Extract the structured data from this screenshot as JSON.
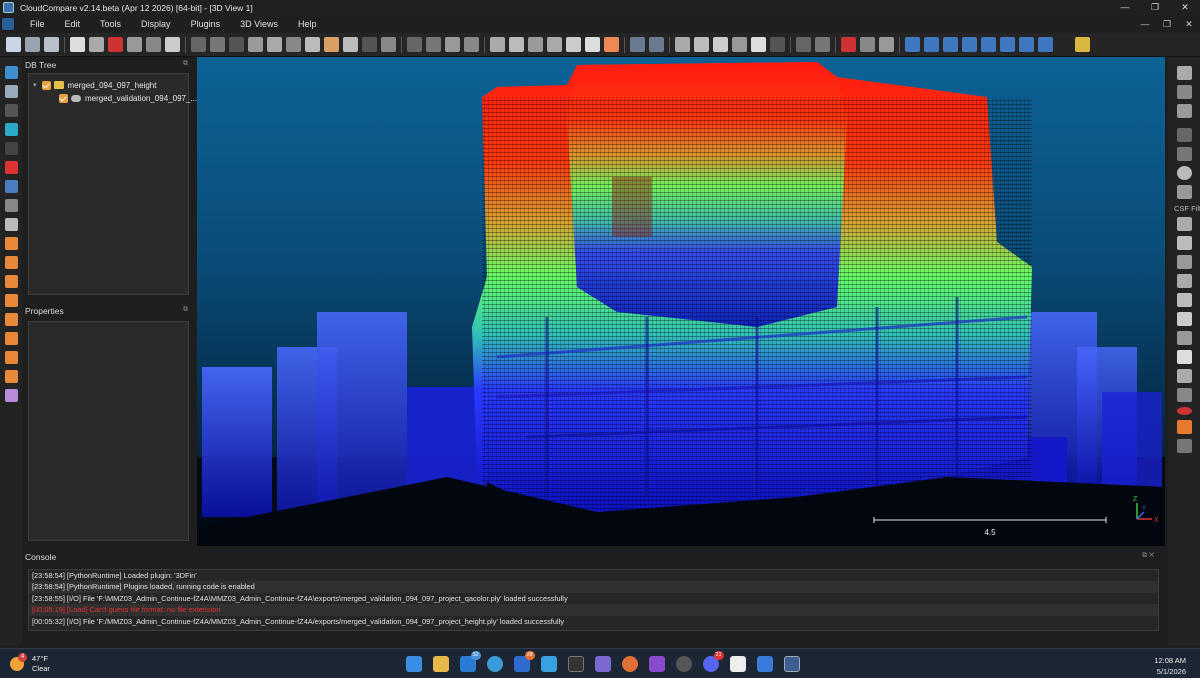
{
  "window": {
    "title": "CloudCompare v2.14.beta (Apr 12 2026) [64-bit] - [3D View 1]",
    "controls": [
      "—",
      "❐",
      "✕"
    ]
  },
  "menu": {
    "items": [
      "File",
      "Edit",
      "Tools",
      "Display",
      "Plugins",
      "3D Views",
      "Help"
    ],
    "mdi_controls": [
      "—",
      "❐",
      "✕"
    ]
  },
  "db_tree": {
    "title": "DB Tree",
    "items": [
      {
        "label": "merged_094_097_height",
        "type": "folder",
        "checked": true
      },
      {
        "label": "merged_validation_094_097_...",
        "type": "cloud",
        "checked": true
      }
    ]
  },
  "properties": {
    "title": "Properties"
  },
  "view": {
    "scale_label": "4.5",
    "axes": {
      "z": "Z",
      "y": "Y",
      "x": "X"
    },
    "background_colors": [
      "#0d6296",
      "#021322"
    ]
  },
  "right_toolbar": {
    "csf_label": "CSF Filte"
  },
  "console": {
    "title": "Console",
    "lines": [
      {
        "text": "[23:58:54] [PythonRuntime]     Loaded plugin: '3DFin'",
        "level": "info"
      },
      {
        "text": "[23:58:54] [PythonRuntime] Plugins loaded, running code is enabled",
        "level": "info"
      },
      {
        "text": "[23:58:55] [I/O] File 'F:\\MMZ03_Admin_Continue-fZ4A\\MMZ03_Admin_Continue-fZ4A\\exports\\merged_validation_094_097_project_qacolor.ply' loaded successfully",
        "level": "info"
      },
      {
        "text": "[00:05:19] [Load] Can't guess file format: no file extension",
        "level": "error"
      },
      {
        "text": "[00:05:32] [I/O] File 'F:/MMZ03_Admin_Continue-fZ4A/MMZ03_Admin_Continue-fZ4A/exports/merged_validation_094_097_project_height.ply' loaded successfully",
        "level": "info"
      }
    ]
  },
  "taskbar": {
    "weather": {
      "temp": "47°F",
      "condition": "Clear",
      "badge": "4"
    },
    "badges": {
      "mail": "32",
      "chat": "28",
      "discord": "21"
    },
    "time": "12:08 AM",
    "date": "5/1/2026"
  },
  "colors": {
    "height_high": "#ff1a10",
    "height_mid": "#66ff66",
    "height_low": "#1a1aff",
    "console_error": "#e23030",
    "accent": "#e8a040"
  }
}
